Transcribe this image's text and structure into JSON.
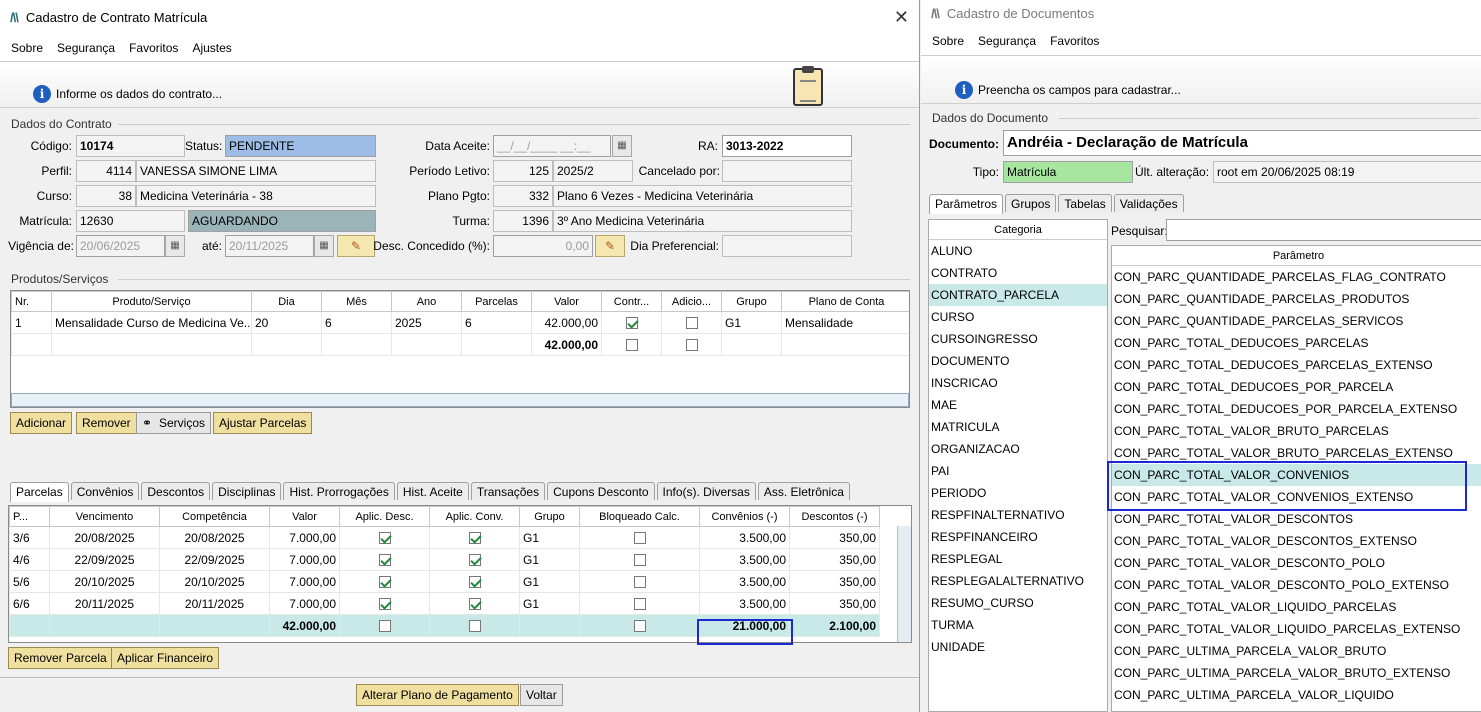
{
  "w1": {
    "title": "Cadastro de Contrato Matrícula",
    "menu": [
      "Sobre",
      "Segurança",
      "Favoritos",
      "Ajustes"
    ],
    "info": "Informe os dados do contrato...",
    "section_contrato": "Dados do Contrato",
    "codigo_label": "Código:",
    "codigo": "10174",
    "status_label": "Status:",
    "status": "PENDENTE",
    "data_aceite_label": "Data Aceite:",
    "data_aceite": "__/__/____ __:__",
    "ra_label": "RA:",
    "ra": "3013-2022",
    "perfil_label": "Perfil:",
    "perfil_code": "4114",
    "perfil_name": "VANESSA SIMONE LIMA",
    "periodo_label": "Período Letivo:",
    "periodo_code": "125",
    "periodo_name": "2025/2",
    "cancelado_label": "Cancelado por:",
    "curso_label": "Curso:",
    "curso_code": "38",
    "curso_name": "Medicina Veterinária - 38",
    "plano_label": "Plano Pgto:",
    "plano_code": "332",
    "plano_name": "Plano 6 Vezes - Medicina Veterinária",
    "matricula_label": "Matrícula:",
    "matricula": "12630",
    "matricula_status": "AGUARDANDO",
    "turma_label": "Turma:",
    "turma_code": "1396",
    "turma_name": "3º Ano Medicina Veterinária",
    "vigencia_label": "Vigência de:",
    "vigencia_de": "20/06/2025",
    "ate_label": "até:",
    "vigencia_ate": "20/11/2025",
    "desc_label": "Desc. Concedido (%):",
    "desc_value": "0,00",
    "dia_pref_label": "Dia Preferencial:",
    "section_produtos": "Produtos/Serviços",
    "prod_headers": [
      "Nr.",
      "Produto/Serviço",
      "Dia",
      "Mês",
      "Ano",
      "Parcelas",
      "Valor",
      "Contr...",
      "Adicio...",
      "Grupo",
      "Plano de Conta"
    ],
    "prod_row": {
      "nr": "1",
      "produto": "Mensalidade Curso de Medicina Ve...",
      "dia": "20",
      "mes": "6",
      "ano": "2025",
      "parcelas": "6",
      "valor": "42.000,00",
      "grupo": "G1",
      "plano": "Mensalidade"
    },
    "prod_total": "42.000,00",
    "btn_adicionar": "Adicionar",
    "btn_remover": "Remover",
    "btn_servicos": "Serviços",
    "btn_ajustar": "Ajustar Parcelas",
    "tabs": [
      "Parcelas",
      "Convênios",
      "Descontos",
      "Disciplinas",
      "Hist. Prorrogações",
      "Hist. Aceite",
      "Transações",
      "Cupons Desconto",
      "Info(s). Diversas",
      "Ass. Eletrônica"
    ],
    "parc_headers": [
      "P...",
      "Vencimento",
      "Competência",
      "Valor",
      "Aplic. Desc.",
      "Aplic. Conv.",
      "Grupo",
      "Bloqueado Calc.",
      "Convênios (-)",
      "Descontos (-)"
    ],
    "parc_rows": [
      {
        "p": "3/6",
        "venc": "20/08/2025",
        "comp": "20/08/2025",
        "valor": "7.000,00",
        "grupo": "G1",
        "conv": "3.500,00",
        "desc": "350,00"
      },
      {
        "p": "4/6",
        "venc": "22/09/2025",
        "comp": "22/09/2025",
        "valor": "7.000,00",
        "grupo": "G1",
        "conv": "3.500,00",
        "desc": "350,00"
      },
      {
        "p": "5/6",
        "venc": "20/10/2025",
        "comp": "20/10/2025",
        "valor": "7.000,00",
        "grupo": "G1",
        "conv": "3.500,00",
        "desc": "350,00"
      },
      {
        "p": "6/6",
        "venc": "20/11/2025",
        "comp": "20/11/2025",
        "valor": "7.000,00",
        "grupo": "G1",
        "conv": "3.500,00",
        "desc": "350,00"
      }
    ],
    "parc_total": {
      "valor": "42.000,00",
      "conv": "21.000,00",
      "desc": "2.100,00"
    },
    "btn_remover_parcela": "Remover Parcela",
    "btn_aplicar_fin": "Aplicar Financeiro",
    "btn_alterar_plano": "Alterar Plano de Pagamento",
    "btn_voltar": "Voltar"
  },
  "w2": {
    "title": "Cadastro de Documentos",
    "menu": [
      "Sobre",
      "Segurança",
      "Favoritos"
    ],
    "info": "Preencha os campos para cadastrar...",
    "section": "Dados do Documento",
    "documento_label": "Documento:",
    "documento": "Andréia - Declaração de Matrícula",
    "tipo_label": "Tipo:",
    "tipo": "Matrícula",
    "ult_label": "Últ. alteração:",
    "ult": "root em 20/06/2025 08:19",
    "tabs": [
      "Parâmetros",
      "Grupos",
      "Tabelas",
      "Validações"
    ],
    "categoria_header": "Categoria",
    "categorias": [
      "ALUNO",
      "CONTRATO",
      "CONTRATO_PARCELA",
      "CURSO",
      "CURSOINGRESSO",
      "DOCUMENTO",
      "INSCRICAO",
      "MAE",
      "MATRICULA",
      "ORGANIZACAO",
      "PAI",
      "PERIODO",
      "RESPFINALTERNATIVO",
      "RESPFINANCEIRO",
      "RESPLEGAL",
      "RESPLEGALALTERNATIVO",
      "RESUMO_CURSO",
      "TURMA",
      "UNIDADE"
    ],
    "pesquisar_label": "Pesquisar:",
    "parametro_header": "Parâmetro",
    "parametros": [
      "CON_PARC_QUANTIDADE_PARCELAS_FLAG_CONTRATO",
      "CON_PARC_QUANTIDADE_PARCELAS_PRODUTOS",
      "CON_PARC_QUANTIDADE_PARCELAS_SERVICOS",
      "CON_PARC_TOTAL_DEDUCOES_PARCELAS",
      "CON_PARC_TOTAL_DEDUCOES_PARCELAS_EXTENSO",
      "CON_PARC_TOTAL_DEDUCOES_POR_PARCELA",
      "CON_PARC_TOTAL_DEDUCOES_POR_PARCELA_EXTENSO",
      "CON_PARC_TOTAL_VALOR_BRUTO_PARCELAS",
      "CON_PARC_TOTAL_VALOR_BRUTO_PARCELAS_EXTENSO",
      "CON_PARC_TOTAL_VALOR_CONVENIOS",
      "CON_PARC_TOTAL_VALOR_CONVENIOS_EXTENSO",
      "CON_PARC_TOTAL_VALOR_DESCONTOS",
      "CON_PARC_TOTAL_VALOR_DESCONTOS_EXTENSO",
      "CON_PARC_TOTAL_VALOR_DESCONTO_POLO",
      "CON_PARC_TOTAL_VALOR_DESCONTO_POLO_EXTENSO",
      "CON_PARC_TOTAL_VALOR_LIQUIDO_PARCELAS",
      "CON_PARC_TOTAL_VALOR_LIQUIDO_PARCELAS_EXTENSO",
      "CON_PARC_ULTIMA_PARCELA_VALOR_BRUTO",
      "CON_PARC_ULTIMA_PARCELA_VALOR_BRUTO_EXTENSO",
      "CON_PARC_ULTIMA_PARCELA_VALOR_LIQUIDO"
    ]
  },
  "colors": {
    "status_bg": "#9dbde6",
    "matricula_status_bg": "#9bb4b8",
    "tipo_bg": "#a6e6a0",
    "highlight": "#1a2ad0",
    "selected": "#c9e8e8"
  }
}
